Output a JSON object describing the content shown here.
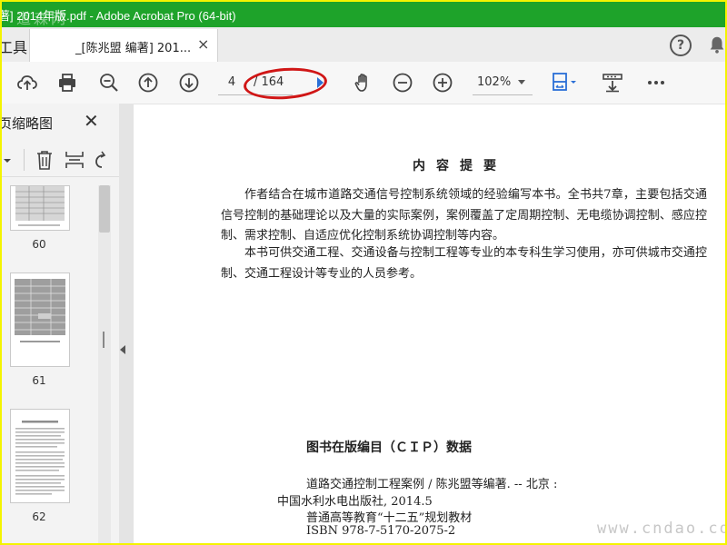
{
  "window": {
    "title": "著] 2014年版.pdf - Adobe Acrobat Pro (64-bit)",
    "watermark": "道森网"
  },
  "tabs": {
    "tools_label": "工具",
    "doc_tab_label": "_[陈兆盟 编著] 201...",
    "close_glyph": "×",
    "help_glyph": "?"
  },
  "toolbar": {
    "current_page": "4",
    "total_pages": "/ 164",
    "zoom": "102%"
  },
  "sidebar": {
    "title": "页缩略图",
    "close_glyph": "✕",
    "thumbnails": [
      {
        "page": "60"
      },
      {
        "page": "61"
      },
      {
        "page": "62"
      }
    ]
  },
  "document": {
    "heading": "内容提要",
    "paragraphs": [
      "作者结合在城市道路交通信号控制系统领域的经验编写本书。全书共7章，主要包括交通信号控制的基础理论以及大量的实际案例，案例覆盖了定周期控制、无电缆协调控制、感应控制、需求控制、自适应优化控制系统协调控制等内容。",
      "本书可供交通工程、交通设备与控制工程等专业的本专科生学习使用，亦可供城市交通控制、交通工程设计等专业的人员参考。"
    ],
    "cip": {
      "title": "图书在版编目（ＣＩＰ）数据",
      "line1": "道路交通控制工程案例 / 陈兆盟等编著. -- 北京 :",
      "line2": "中国水利水电出版社, 2014.5",
      "line3": "普通高等教育“十二五”规划教材",
      "line4": "ISBN 978-7-5170-2075-2"
    },
    "site_watermark": "www.cndao.com"
  },
  "colors": {
    "titlebar": "#1ea32a",
    "frame": "#f4f400",
    "annotation": "#d01616",
    "accent_blue": "#2a6fd6"
  }
}
